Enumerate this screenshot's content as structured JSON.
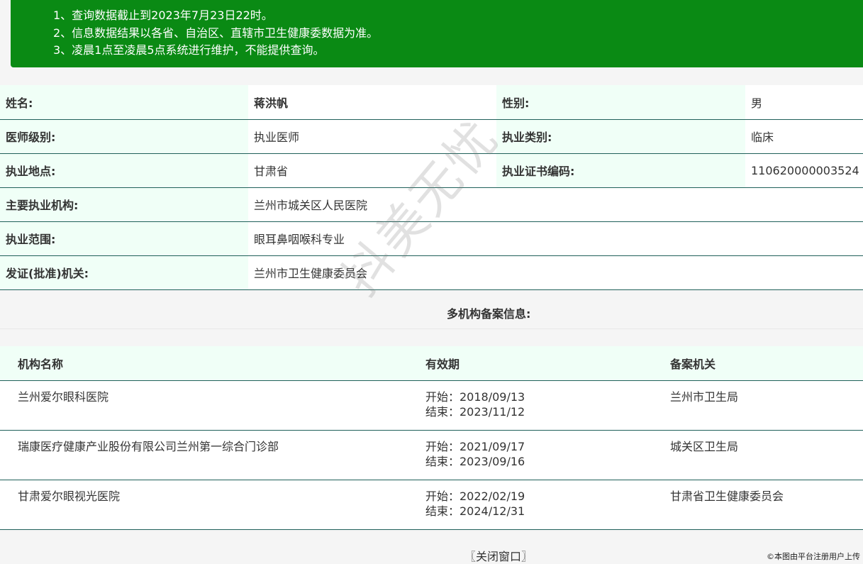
{
  "notice": {
    "lines": [
      "1、查询数据截止到2023年7月23日22时。",
      "2、信息数据结果以各省、自治区、直辖市卫生健康委数据为准。",
      "3、凌晨1点至凌晨5点系统进行维护，不能提供查询。"
    ]
  },
  "doctor": {
    "name_label": "姓名:",
    "name": "蒋洪帆",
    "gender_label": "性别:",
    "gender": "男",
    "level_label": "医师级别:",
    "level": "执业医师",
    "category_label": "执业类别:",
    "category": "临床",
    "location_label": "执业地点:",
    "location": "甘肃省",
    "cert_label": "执业证书编码:",
    "cert": "110620000003524",
    "institution_label": "主要执业机构:",
    "institution": "兰州市城关区人民医院",
    "scope_label": "执业范围:",
    "scope": "眼耳鼻咽喉科专业",
    "authority_label": "发证(批准)机关:",
    "authority": "兰州市卫生健康委员会"
  },
  "multi": {
    "title": "多机构备案信息:",
    "headers": [
      "机构名称",
      "有效期",
      "备案机关"
    ],
    "rows": [
      {
        "name": "兰州爱尔眼科医院",
        "start": "开始：2018/09/13",
        "end": "结束：2023/11/12",
        "authority": "兰州市卫生局"
      },
      {
        "name": "瑞康医疗健康产业股份有限公司兰州第一综合门诊部",
        "start": "开始：2021/09/17",
        "end": "结束：2023/09/16",
        "authority": "城关区卫生局"
      },
      {
        "name": "甘肃爱尔眼视光医院",
        "start": "开始：2022/02/19",
        "end": "结束：2024/12/31",
        "authority": "甘肃省卫生健康委员会"
      }
    ]
  },
  "close_label": "〖关闭窗口〗",
  "watermark": "抖美无忧",
  "copyright": "©本图由平台注册用户上传",
  "colors": {
    "notice_bg": "#0a8a14",
    "label_bg": "#f0fff7",
    "border": "#20605a"
  }
}
